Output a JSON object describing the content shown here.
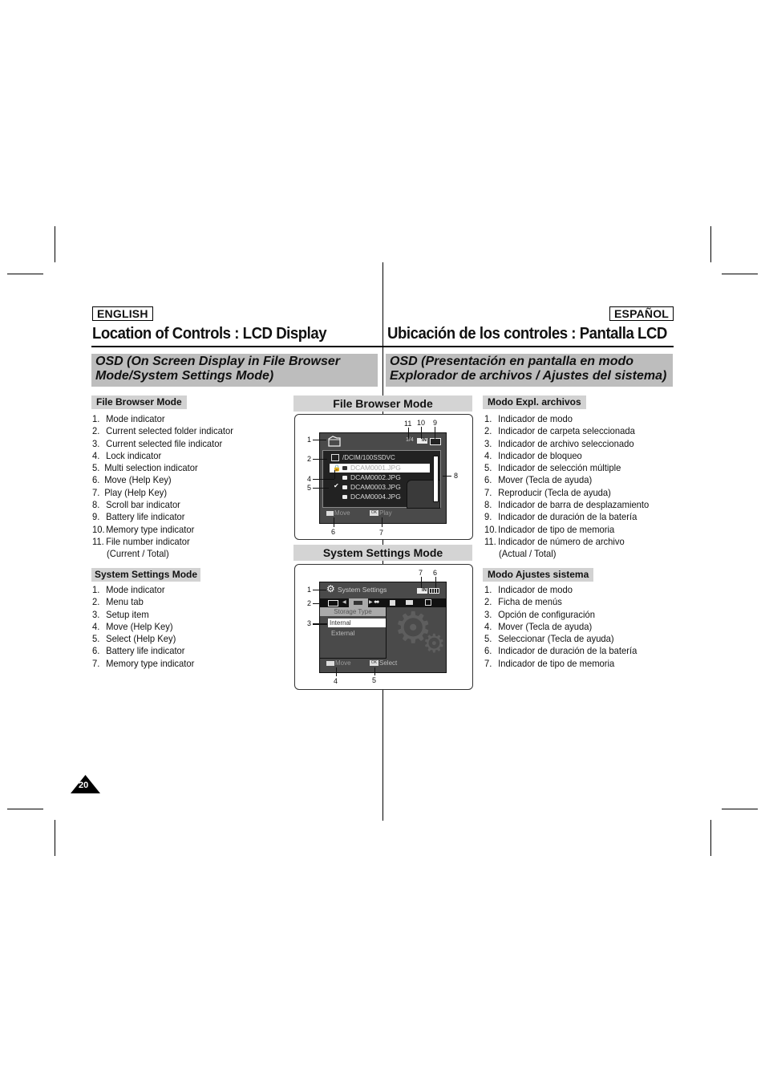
{
  "page": {
    "number": "20"
  },
  "english": {
    "language_label": "ENGLISH",
    "title": "Location of Controls : LCD Display",
    "osd_banner_line1": "OSD (On Screen Display in File Browser",
    "osd_banner_line2": "Mode/System Settings Mode)",
    "file_browser": {
      "heading": "File Browser Mode",
      "items": [
        {
          "num": "1.",
          "text": "Mode indicator"
        },
        {
          "num": "2.",
          "text": "Current selected folder indicator"
        },
        {
          "num": "3.",
          "text": "Current selected file indicator"
        },
        {
          "num": "4.",
          "text": "Lock indicator"
        },
        {
          "num": "5.",
          "text": "Multi selection indicator"
        },
        {
          "num": "6.",
          "text": "Move (Help Key)"
        },
        {
          "num": "7.",
          "text": "Play  (Help Key)"
        },
        {
          "num": "8.",
          "text": "Scroll bar indicator"
        },
        {
          "num": "9.",
          "text": "Battery life indicator"
        },
        {
          "num": "10.",
          "text": "Memory type indicator"
        },
        {
          "num": "11.",
          "text": "File number indicator"
        }
      ],
      "item11_cont": "(Current / Total)"
    },
    "system_settings": {
      "heading": "System Settings Mode",
      "items": [
        {
          "num": "1.",
          "text": "Mode indicator"
        },
        {
          "num": "2.",
          "text": "Menu tab"
        },
        {
          "num": "3.",
          "text": "Setup item"
        },
        {
          "num": "4.",
          "text": "Move (Help Key)"
        },
        {
          "num": "5.",
          "text": "Select (Help Key)"
        },
        {
          "num": "6.",
          "text": "Battery life indicator"
        },
        {
          "num": "7.",
          "text": "Memory type indicator"
        }
      ]
    }
  },
  "spanish": {
    "language_label": "ESPAÑOL",
    "title": "Ubicación de los controles : Pantalla LCD",
    "osd_banner_line1": "OSD (Presentación en pantalla en modo",
    "osd_banner_line2": "Explorador de archivos / Ajustes del sistema)",
    "file_browser": {
      "heading": "Modo Expl. archivos",
      "items": [
        {
          "num": "1.",
          "text": "Indicador de modo"
        },
        {
          "num": "2.",
          "text": "Indicador de carpeta seleccionada"
        },
        {
          "num": "3.",
          "text": "Indicador de archivo seleccionado"
        },
        {
          "num": "4.",
          "text": "Indicador de bloqueo"
        },
        {
          "num": "5.",
          "text": "Indicador de selección múltiple"
        },
        {
          "num": "6.",
          "text": "Mover (Tecla de ayuda)"
        },
        {
          "num": "7.",
          "text": "Reproducir (Tecla de ayuda)"
        },
        {
          "num": "8.",
          "text": "Indicador de barra de desplazamiento"
        },
        {
          "num": "9.",
          "text": "Indicador de duración de la batería"
        },
        {
          "num": "10.",
          "text": "Indicador de tipo de memoria"
        },
        {
          "num": "11.",
          "text": "Indicador de número de archivo"
        }
      ],
      "item11_cont": "(Actual / Total)"
    },
    "system_settings": {
      "heading": "Modo Ajustes sistema",
      "items": [
        {
          "num": "1.",
          "text": "Indicador de modo"
        },
        {
          "num": "2.",
          "text": "Ficha de menús"
        },
        {
          "num": "3.",
          "text": "Opción de configuración"
        },
        {
          "num": "4.",
          "text": "Mover (Tecla de ayuda)"
        },
        {
          "num": "5.",
          "text": "Seleccionar (Tecla de ayuda)"
        },
        {
          "num": "6.",
          "text": "Indicador de duración de la batería"
        },
        {
          "num": "7.",
          "text": "Indicador de tipo de memoria"
        }
      ]
    }
  },
  "figure_file_browser": {
    "heading": "File Browser Mode",
    "file_counter": "1/4",
    "memory_label": "IN",
    "folder_path": "/DCIM/100SSDVC",
    "files": [
      "DCAM0001.JPG",
      "DCAM0002.JPG",
      "DCAM0003.JPG",
      "DCAM0004.JPG"
    ],
    "selected_index": 0,
    "locked_index": 0,
    "checked_index": 2,
    "help_move": "Move",
    "help_play": "Play",
    "help_ok": "OK",
    "callouts": {
      "c1": "1",
      "c2": "2",
      "c4": "4",
      "c5": "5",
      "c6": "6",
      "c7": "7",
      "c8": "8",
      "c9": "9",
      "c10": "10",
      "c11": "11"
    }
  },
  "figure_system_settings": {
    "heading": "System Settings Mode",
    "title": "System Settings",
    "memory_label": "IN",
    "menu_heading": "Storage Type",
    "options": [
      "Internal",
      "External"
    ],
    "selected_index": 0,
    "help_move": "Move",
    "help_select": "Select",
    "help_ok": "OK",
    "callouts": {
      "c1": "1",
      "c2": "2",
      "c3": "3",
      "c4": "4",
      "c5": "5",
      "c6": "6",
      "c7": "7"
    }
  }
}
